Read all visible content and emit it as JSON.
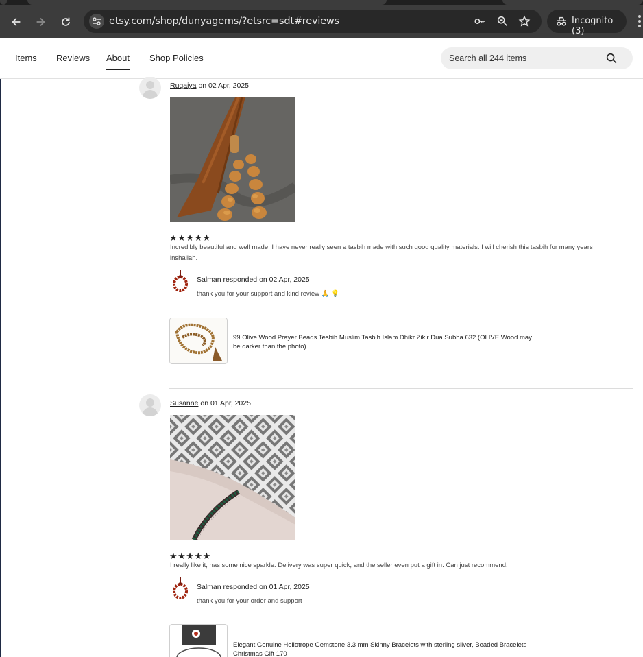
{
  "browser": {
    "url": "etsy.com/shop/dunyagems/?etsrc=sdt#reviews",
    "incognito_label": "Incognito (3)",
    "icons": [
      "back-arrow-icon",
      "forward-arrow-icon",
      "reload-icon",
      "site-settings-icon",
      "key-icon",
      "zoom-icon",
      "star-icon",
      "incognito-icon",
      "more-icon"
    ]
  },
  "shop_nav": {
    "tabs": [
      {
        "label": "Items",
        "active": false
      },
      {
        "label": "Reviews",
        "active": false
      },
      {
        "label": "About",
        "active": true
      },
      {
        "label": "Shop Policies",
        "active": false
      }
    ],
    "search_placeholder": "Search all 244 items"
  },
  "reviews": [
    {
      "author": "Ruqaiya",
      "date_text": " on 02 Apr, 2025",
      "rating": 5,
      "stars": "★★★★★",
      "text": "Incredibly beautiful and well made. I have never really seen a tasbih made with such good quality materials. I will cherish this tasbih for many years inshallah.",
      "response": {
        "seller": "Salman",
        "meta": " responded on 02 Apr, 2025",
        "text": "thank you for your support and kind review 🙏 💡"
      },
      "item_title": "99 Olive Wood Prayer Beads Tesbih Muslim Tasbih Islam Dhikr Zikir Dua Subha 632 (OLIVE Wood may be darker than the photo)"
    },
    {
      "author": "Susanne",
      "date_text": " on 01 Apr, 2025",
      "rating": 5,
      "stars": "★★★★★",
      "text": "I really like it, has some nice sparkle. Delivery was super quick, and the seller even put a gift in. Can just recommend.",
      "response": {
        "seller": "Salman",
        "meta": " responded on 01 Apr, 2025",
        "text": "thank you for your order and support"
      },
      "item_title": "Elegant Genuine Heliotrope Gemstone 3.3 mm Skinny Bracelets with sterling silver, Beaded Bracelets Christmas Gift 170"
    }
  ],
  "colors": {
    "chrome_dark": "#3c3c3c",
    "omnibox": "#282828",
    "search_bg": "#efefef",
    "text": "#222222"
  }
}
